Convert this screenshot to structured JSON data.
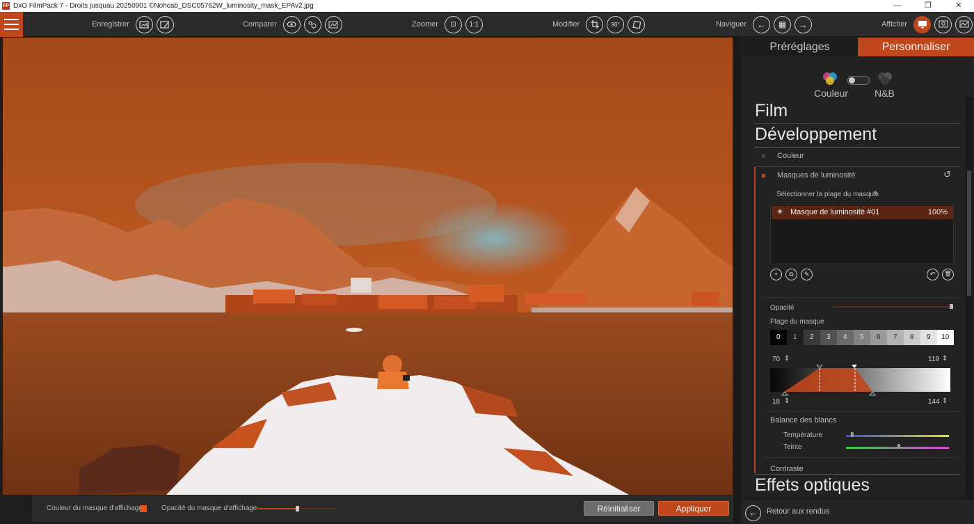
{
  "window": {
    "title": "DxO FilmPack 7 - Droits jusquau 20250901 ©Nohcab_DSC05762W_luminosity_mask_EPAv2.jpg",
    "app_icon": "FP",
    "min_glyph": "—",
    "max_glyph": "❐",
    "close_glyph": "✕"
  },
  "toolbar": {
    "save_label": "Enregistrer",
    "compare_label": "Comparer",
    "zoom_label": "Zoomer",
    "zoom_11": "1:1",
    "zoom_fit_glyph": "⊡",
    "edit_label": "Modifier",
    "rotate_label": "90°",
    "navigate_label": "Naviguer",
    "nav_prev_glyph": "←",
    "nav_grid_glyph": "▦",
    "nav_next_glyph": "→",
    "display_label": "Afficher"
  },
  "photobar": {
    "mask_color_label": "Couleur du masque d'affichage",
    "mask_color": "#e0561d",
    "mask_opacity_label": "Opacité du masque d'affichage",
    "mask_opacity_value": 0.5,
    "reset_label": "Réinitialiser",
    "apply_label": "Appliquer"
  },
  "panel": {
    "tabs": [
      "Préréglages",
      "Personnaliser"
    ],
    "active_tab": "Personnaliser",
    "mode_color": "Couleur",
    "mode_bw": "N&B",
    "sections": {
      "film": "Film",
      "development": "Développement",
      "optical": "Effets optiques"
    },
    "sub_couleur": "Couleur",
    "sub_masks": "Masques de luminosité",
    "reset_glyph": "↺",
    "select_range": "Sélectionner la plage du masque",
    "eyedropper_glyph": "✎",
    "mask_items": [
      {
        "name": "Masque de luminosité #01",
        "value": "100%"
      }
    ],
    "mask_icon_glyph": "☀",
    "btn_add": "+",
    "btn_copy": "⧉",
    "btn_edit": "✎",
    "btn_undo": "↶",
    "btn_delete": "🗑",
    "opacity_label": "Opacité",
    "opacity_value": 1.0,
    "range_label": "Plage du masque",
    "range_cells": [
      "0",
      "1",
      "2",
      "3",
      "4",
      "5",
      "6",
      "7",
      "8",
      "9",
      "10"
    ],
    "range_top_left": "70",
    "range_top_right": "119",
    "range_bottom_left": "18",
    "range_bottom_right": "144",
    "stepper_glyph": "⇕",
    "wb_label": "Balance des blancs",
    "temp_label": "Température",
    "tint_label": "Teinte",
    "temp_value": 0.05,
    "tint_value": 0.5,
    "contrast_label": "Contraste",
    "back_label": "Retour aux rendus",
    "back_glyph": "←"
  },
  "colors": {
    "accent": "#c0471b",
    "panel_bg": "#222222",
    "toolbar_bg": "#2b2b2b"
  }
}
